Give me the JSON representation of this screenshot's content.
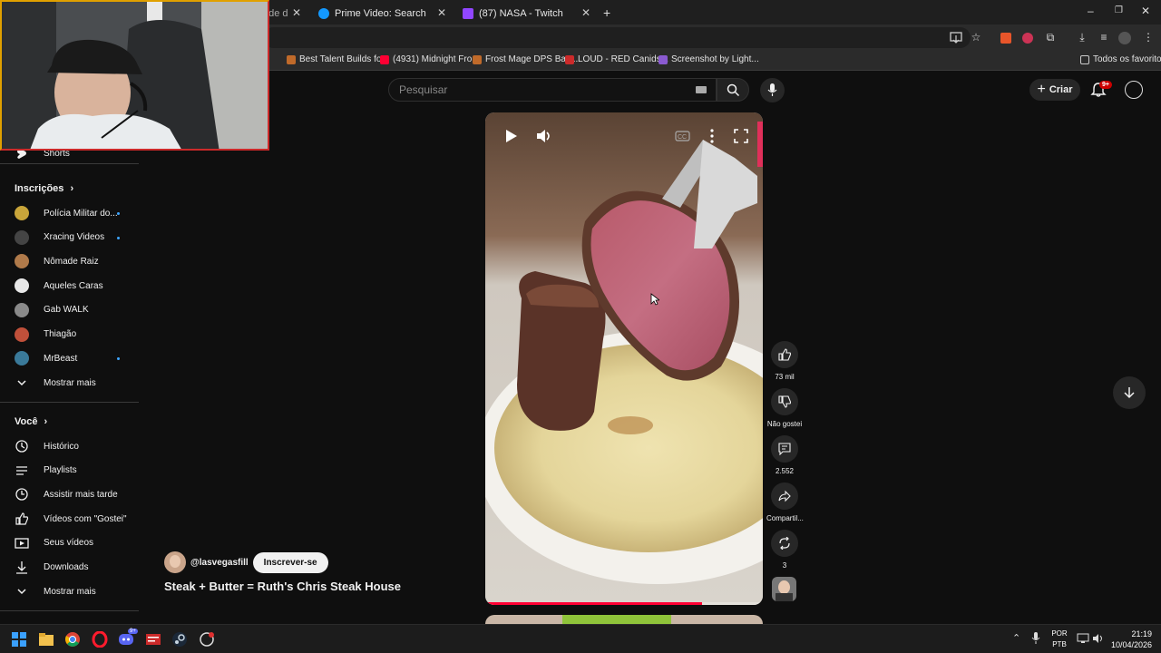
{
  "browser": {
    "tabs": [
      {
        "title": "nde d",
        "active": false
      },
      {
        "title": "Prime Video: Search",
        "active": false
      },
      {
        "title": "(87) NASA - Twitch",
        "active": false
      }
    ],
    "bookmarks": [
      "Best Talent Builds fo...",
      "(4931) Midnight Fro...",
      "Frost Mage DPS Bas...",
      "LOUD - RED Canids...",
      "Screenshot by Light..."
    ],
    "bookmark_folder": "Todos os favoritos"
  },
  "youtube": {
    "search_placeholder": "Pesquisar",
    "create_label": "Criar",
    "notif_count": "9+"
  },
  "sidebar": {
    "shorts_label": "Shorts",
    "subscriptions_heading": "Inscrições",
    "subscriptions": [
      {
        "name": "Polícia Militar do...",
        "new": true,
        "color": "#c9a53a"
      },
      {
        "name": "Xracing Videos",
        "new": true,
        "color": "#444444"
      },
      {
        "name": "Nômade Raiz",
        "new": false,
        "color": "#b07a4a"
      },
      {
        "name": "Aqueles Caras",
        "new": false,
        "color": "#e8e8e8"
      },
      {
        "name": "Gab WALK",
        "new": false,
        "color": "#8a8a8a"
      },
      {
        "name": "Thiagão",
        "new": false,
        "color": "#c0503a"
      },
      {
        "name": "MrBeast",
        "new": true,
        "color": "#3a7a9a"
      }
    ],
    "show_more_subs": "Mostrar mais",
    "you_heading": "Você",
    "you_items": [
      {
        "label": "Histórico",
        "icon": "history-icon"
      },
      {
        "label": "Playlists",
        "icon": "playlists-icon"
      },
      {
        "label": "Assistir mais tarde",
        "icon": "watch-later-icon"
      },
      {
        "label": "Vídeos com \"Gostei\"",
        "icon": "thumbs-up-icon"
      },
      {
        "label": "Seus vídeos",
        "icon": "your-videos-icon"
      },
      {
        "label": "Downloads",
        "icon": "download-icon"
      }
    ],
    "show_more_you": "Mostrar mais"
  },
  "player": {
    "progress": 0.78
  },
  "actions": {
    "likes": "73 mil",
    "dislike_label": "Não gostei",
    "comments": "2.552",
    "share_label": "Compartil...",
    "remix_count": "3"
  },
  "video": {
    "channel": "@lasvegasfill",
    "subscribe_label": "Inscrever-se",
    "title": "Steak + Butter = Ruth's Chris Steak House"
  },
  "taskbar": {
    "lang_line1": "POR",
    "lang_line2": "PTB",
    "time": "21:19",
    "date": "10/04/2026",
    "chat_badge": "9+"
  }
}
